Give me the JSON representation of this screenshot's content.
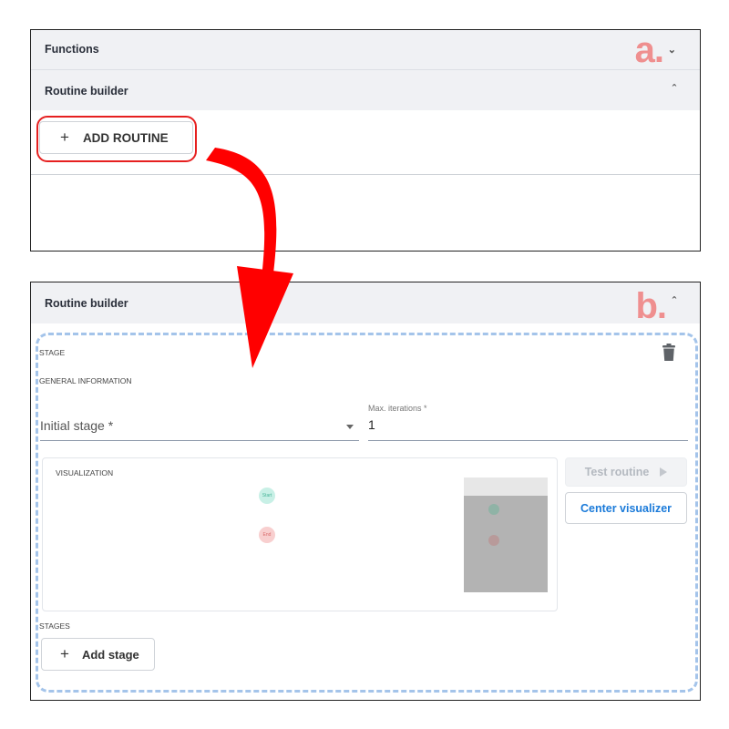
{
  "panel_a": {
    "functions_title": "Functions",
    "routine_builder_title": "Routine builder",
    "letter": "a.",
    "add_routine_label": "ADD ROUTINE",
    "plus_symbol": "+"
  },
  "panel_b": {
    "routine_builder_title": "Routine builder",
    "letter": "b.",
    "stage_label": "STAGE",
    "general_info_label": "GENERAL INFORMATION",
    "initial_stage_placeholder": "Initial stage *",
    "max_iterations_label": "Max. iterations *",
    "max_iterations_value": "1",
    "visualization_label": "VISUALIZATION",
    "start_node": "Start",
    "end_node": "End",
    "test_routine_label": "Test routine",
    "center_visualizer_label": "Center visualizer",
    "stages_label": "STAGES",
    "add_stage_label": "Add stage",
    "plus_symbol": "+"
  },
  "colors": {
    "highlight_red": "#e62020",
    "arrow_red": "#ff0000",
    "dashed_blue": "#a4c4ea",
    "accent_blue": "#1a7ad9",
    "letter_pink": "#ef8f8f",
    "start_node": "#c8f0e6",
    "end_node": "#f8cfcf"
  },
  "icons": [
    "chevron-down-icon",
    "chevron-up-icon",
    "trash-icon",
    "dropdown-arrow-icon",
    "play-icon",
    "plus-icon"
  ]
}
